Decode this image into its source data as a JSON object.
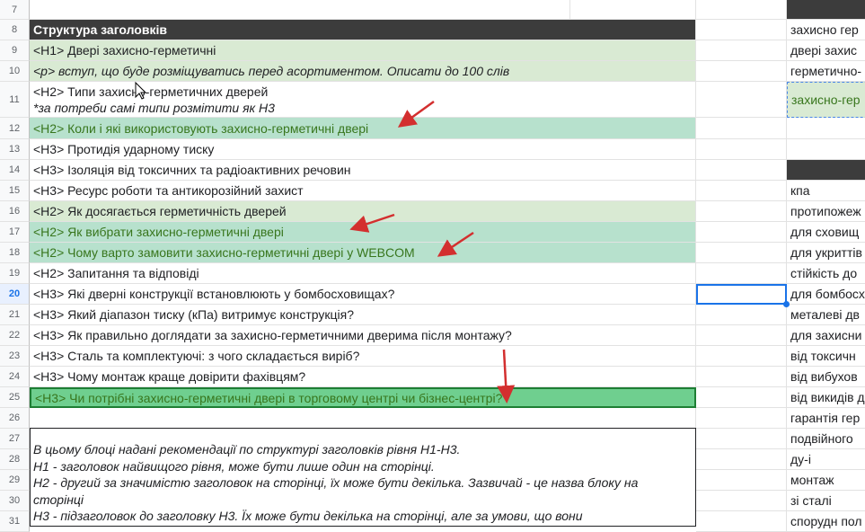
{
  "rows": [
    {
      "num": "7"
    },
    {
      "num": "8",
      "a": "Структура заголовків",
      "c": ""
    },
    {
      "num": "9",
      "a": "<H1> Двері захисно-герметичні",
      "c": "захисно гер"
    },
    {
      "num": "10",
      "a": "<p> вступ, що буде розміщуватись перед асортиментом. Описати до 100 слів",
      "c": "двері захис"
    },
    {
      "num": "11",
      "a": "<H2> Типи захисно-герметичних дверей",
      "a2": "*за потреби самі типи розмітити як Н3",
      "c": "герметично-"
    },
    {
      "num": "12",
      "a": "<H2> Коли і які використовують захисно-герметичні двері",
      "c": "захисно-гер"
    },
    {
      "num": "13",
      "a": "<H3> Протидія ударному тиску",
      "c": ""
    },
    {
      "num": "14",
      "a": "<H3> Ізоляція від токсичних та радіоактивних речовин",
      "c": ""
    },
    {
      "num": "15",
      "a": "<H3> Ресурс роботи та антикорозійний захист",
      "c": "кпа"
    },
    {
      "num": "16",
      "a": "<H2> Як досягається герметичність дверей",
      "c": "протипожеж"
    },
    {
      "num": "17",
      "a": "<H2> Як вибрати захисно-герметичні двері",
      "c": "для сховищ"
    },
    {
      "num": "18",
      "a": "<H2> Чому варто замовити захисно-герметичні двері у WEBCOM",
      "c": "для укриттів"
    },
    {
      "num": "19",
      "a": "<H2> Запитання та відповіді",
      "c": "стійкість до"
    },
    {
      "num": "20",
      "a": "<H3> Які дверні конструкції встановлюють у бомбосховищах?",
      "c": "для бомбосх"
    },
    {
      "num": "21",
      "a": "<H3> Який діапазон тиску (кПа) витримує конструкція?",
      "c": "металеві дв"
    },
    {
      "num": "22",
      "a": "<H3> Як правильно доглядати за захисно-герметичними дверима після монтажу?",
      "c": "для захисни"
    },
    {
      "num": "23",
      "a": "<H3> Сталь та комплектуючі: з чого складається виріб?",
      "c": "від токсичн"
    },
    {
      "num": "24",
      "a": "<H3> Чому монтаж краще довірити фахівцям?",
      "c": "від вибухов"
    },
    {
      "num": "25",
      "a": "<H3> Чи потрібні захисно-герметичні двері в торговому центрі чи бізнес-центрі?",
      "c": "від викидів д"
    },
    {
      "num": "26",
      "a": "",
      "c": "гарантія гер"
    },
    {
      "num": "27",
      "c": "подвійного"
    },
    {
      "num": "28",
      "c": "ду-і"
    },
    {
      "num": "29",
      "c": "монтаж"
    },
    {
      "num": "30",
      "c": "зі сталі"
    },
    {
      "num": "31",
      "c": "спорудн пол"
    }
  ],
  "note": {
    "line1": "В цьому блоці надані рекомендації по структурі заголовків рівня Н1-Н3.",
    "line2": "Н1 - заголовок найвищого рівня, може бути лише один на сторінці.",
    "line3": "Н2 - другий за значимістю заголовок на сторінці, їх може бути декілька. Зазвичай - це назва блоку на",
    "line4": "сторінці",
    "line5": "Н3 - підзаголовок до заголовку Н3. Їх може бути декілька на сторінці, але за умови, що вони"
  },
  "colors": {
    "header": "#3c3c3c",
    "light_green": "#d9ead3",
    "mid_green": "#b7e1cd",
    "selected_green": "#6fcf8f",
    "arrow": "#d32f2f",
    "active_blue": "#1a73e8"
  },
  "active_row": "20"
}
